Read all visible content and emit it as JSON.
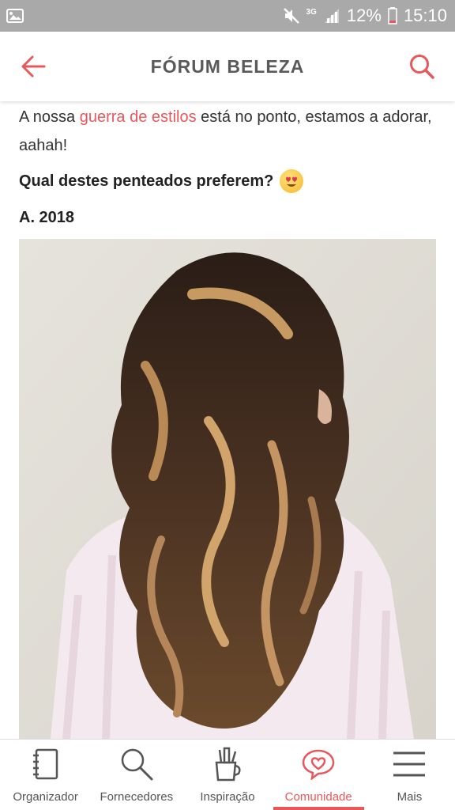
{
  "status_bar": {
    "network": "3G",
    "battery": "12%",
    "time": "15:10"
  },
  "header": {
    "title": "FÓRUM BELEZA",
    "back_icon": "arrow-left-icon",
    "search_icon": "search-icon"
  },
  "post": {
    "intro_before": "A nossa ",
    "intro_link": "guerra de estilos",
    "intro_after": " está no ponto, estamos a adorar, aahah!",
    "question": "Qual destes penteados preferem?",
    "option_label": "A. 2018"
  },
  "bottom_nav": {
    "items": [
      {
        "label": "Organizador",
        "icon": "notebook-icon"
      },
      {
        "label": "Fornecedores",
        "icon": "search-icon"
      },
      {
        "label": "Inspiração",
        "icon": "pencil-cup-icon"
      },
      {
        "label": "Comunidade",
        "icon": "heart-bubble-icon"
      },
      {
        "label": "Mais",
        "icon": "menu-icon"
      }
    ],
    "active": "Comunidade"
  },
  "colors": {
    "accent": "#e8575b",
    "status_bar": "#a9a9a9",
    "title_text": "#5a5a5a"
  }
}
